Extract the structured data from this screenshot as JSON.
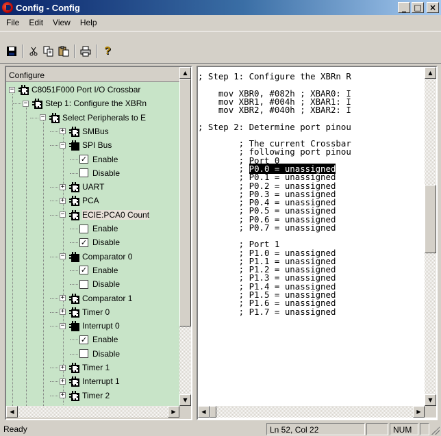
{
  "window": {
    "title": "Config - Config"
  },
  "title_buttons": {
    "minimize": "_",
    "maximize": "□",
    "close": "×"
  },
  "menu": [
    "File",
    "Edit",
    "View",
    "Help"
  ],
  "toolbar": [
    "save-icon",
    "cut-icon",
    "copy-icon",
    "paste-icon",
    "print-icon",
    "help-icon"
  ],
  "left_pane": {
    "header": "Configure"
  },
  "tree": [
    {
      "label": "C8051F000 Port I/O Crossbar",
      "indent": 0,
      "type": "node",
      "expander": "−",
      "chip": "open"
    },
    {
      "label": "Step 1: Configure the XBRn",
      "indent": 1,
      "type": "node",
      "expander": "−",
      "chip": "open"
    },
    {
      "label": "Select Peripherals to E",
      "indent": 2,
      "type": "node",
      "expander": "−",
      "chip": "open"
    },
    {
      "label": "SMBus",
      "indent": 3,
      "type": "node",
      "expander": "+",
      "chip": "open"
    },
    {
      "label": "SPI Bus",
      "indent": 3,
      "type": "node",
      "expander": "−",
      "chip": "filled"
    },
    {
      "label": "Enable",
      "indent": 4,
      "type": "check",
      "checked": true
    },
    {
      "label": "Disable",
      "indent": 4,
      "type": "check",
      "checked": false
    },
    {
      "label": "UART",
      "indent": 3,
      "type": "node",
      "expander": "+",
      "chip": "open"
    },
    {
      "label": "PCA",
      "indent": 3,
      "type": "node",
      "expander": "+",
      "chip": "open"
    },
    {
      "label": "ECIE:PCA0 Count",
      "indent": 3,
      "type": "node",
      "expander": "−",
      "chip": "open",
      "highlight": true
    },
    {
      "label": "Enable",
      "indent": 4,
      "type": "check",
      "checked": false
    },
    {
      "label": "Disable",
      "indent": 4,
      "type": "check",
      "checked": true
    },
    {
      "label": "Comparator 0",
      "indent": 3,
      "type": "node",
      "expander": "−",
      "chip": "filled"
    },
    {
      "label": "Enable",
      "indent": 4,
      "type": "check",
      "checked": true
    },
    {
      "label": "Disable",
      "indent": 4,
      "type": "check",
      "checked": false
    },
    {
      "label": "Comparator 1",
      "indent": 3,
      "type": "node",
      "expander": "+",
      "chip": "open"
    },
    {
      "label": "Timer 0",
      "indent": 3,
      "type": "node",
      "expander": "+",
      "chip": "open"
    },
    {
      "label": "Interrupt 0",
      "indent": 3,
      "type": "node",
      "expander": "−",
      "chip": "filled"
    },
    {
      "label": "Enable",
      "indent": 4,
      "type": "check",
      "checked": true
    },
    {
      "label": "Disable",
      "indent": 4,
      "type": "check",
      "checked": false
    },
    {
      "label": "Timer 1",
      "indent": 3,
      "type": "node",
      "expander": "+",
      "chip": "open"
    },
    {
      "label": "Interrupt 1",
      "indent": 3,
      "type": "node",
      "expander": "+",
      "chip": "open"
    },
    {
      "label": "Timer 2",
      "indent": 3,
      "type": "node",
      "expander": "+",
      "chip": "open"
    }
  ],
  "code_lines": [
    {
      "text": "; Step 1: Configure the XBRn R",
      "row": 0
    },
    {
      "text": "    mov XBR0, #082h ; XBAR0: I",
      "row": 2
    },
    {
      "text": "    mov XBR1, #004h ; XBAR1: I",
      "row": 3
    },
    {
      "text": "    mov XBR2, #040h ; XBAR2: I",
      "row": 4
    },
    {
      "text": "; Step 2: Determine port pinou",
      "row": 6
    },
    {
      "text": "        ; The current Crossbar",
      "row": 8
    },
    {
      "text": "        ; following port pinou",
      "row": 9
    },
    {
      "text": "        ; Port 0",
      "row": 10
    },
    {
      "text": "        ; ",
      "sel": "P0.0 = unassigned",
      "row": 11
    },
    {
      "text": "        ; P0.1 = unassigned",
      "row": 12
    },
    {
      "text": "        ; P0.2 = unassigned",
      "row": 13
    },
    {
      "text": "        ; P0.3 = unassigned",
      "row": 14
    },
    {
      "text": "        ; P0.4 = unassigned",
      "row": 15
    },
    {
      "text": "        ; P0.5 = unassigned",
      "row": 16
    },
    {
      "text": "        ; P0.6 = unassigned",
      "row": 17
    },
    {
      "text": "        ; P0.7 = unassigned",
      "row": 18
    },
    {
      "text": "        ; Port 1",
      "row": 20
    },
    {
      "text": "        ; P1.0 = unassigned",
      "row": 21
    },
    {
      "text": "        ; P1.1 = unassigned",
      "row": 22
    },
    {
      "text": "        ; P1.2 = unassigned",
      "row": 23
    },
    {
      "text": "        ; P1.3 = unassigned",
      "row": 24
    },
    {
      "text": "        ; P1.4 = unassigned",
      "row": 25
    },
    {
      "text": "        ; P1.5 = unassigned",
      "row": 26
    },
    {
      "text": "        ; P1.6 = unassigned",
      "row": 27
    },
    {
      "text": "        ; P1.7 = unassigned",
      "row": 28
    }
  ],
  "status": {
    "text": "Ready",
    "position": "Ln 52, Col 22",
    "num": "NUM"
  },
  "colors": {
    "title_start": "#0a246a",
    "title_end": "#a6caf0",
    "tree_bg": "#c8e4c8",
    "face": "#d4d0c8"
  }
}
